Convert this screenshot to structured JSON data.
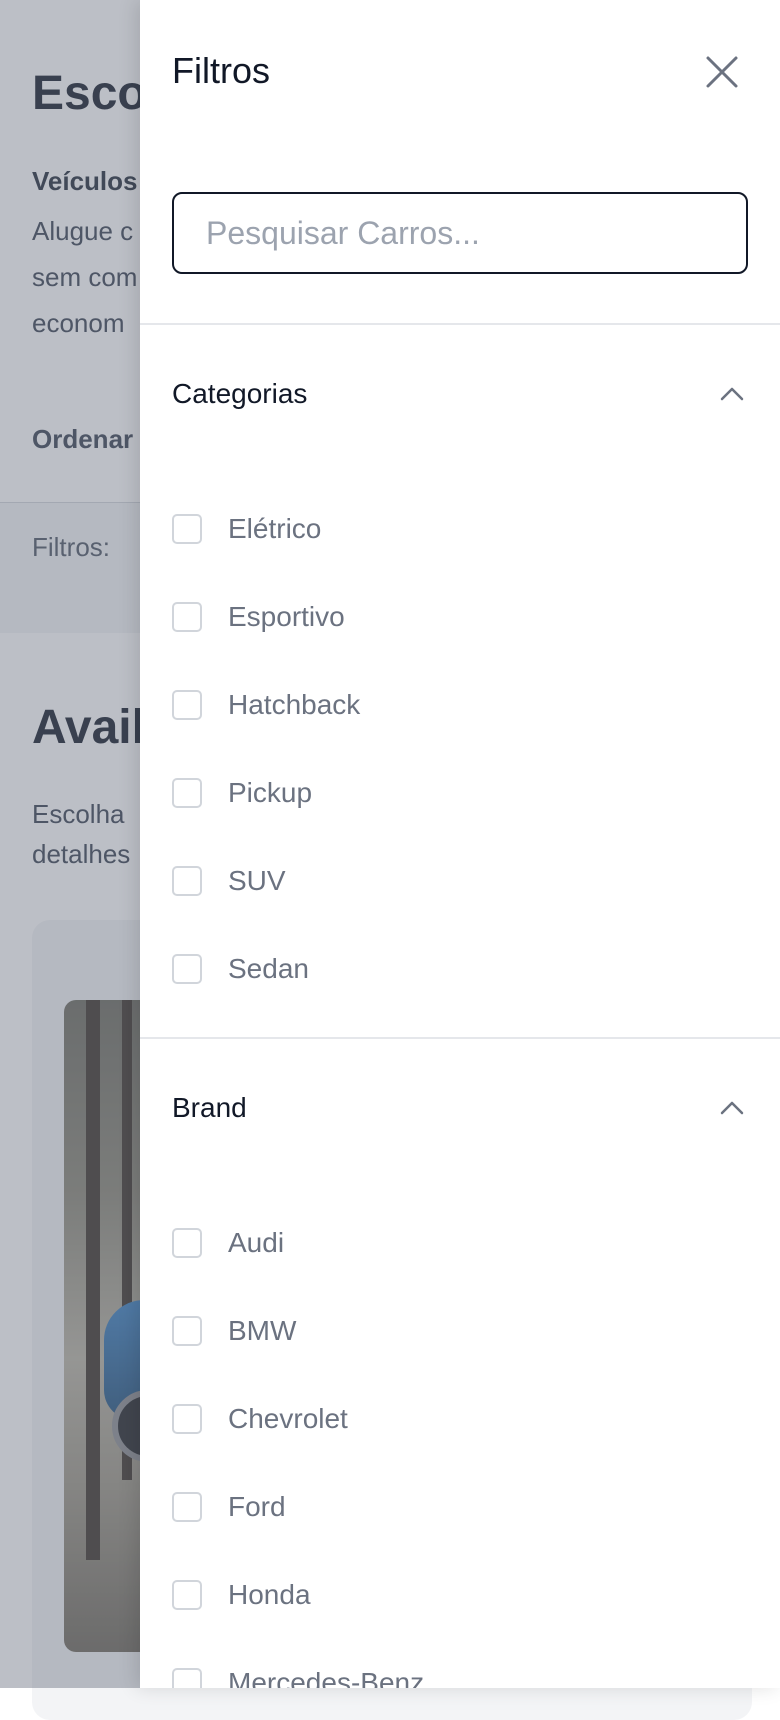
{
  "background": {
    "title": "Esco",
    "subtitle": "Veículos",
    "description_lines": [
      "Alugue c",
      "sem com",
      "econom"
    ],
    "sort_label": "Ordenar",
    "filters_label": "Filtros:",
    "available_title": "Avail",
    "available_desc_lines": [
      "Escolha",
      "detalhes"
    ]
  },
  "drawer": {
    "title": "Filtros",
    "close_icon": "close-icon",
    "search": {
      "placeholder": "Pesquisar Carros...",
      "value": ""
    },
    "sections": [
      {
        "title": "Categorias",
        "expanded": true,
        "chevron_icon": "chevron-up-icon",
        "options": [
          "Elétrico",
          "Esportivo",
          "Hatchback",
          "Pickup",
          "SUV",
          "Sedan"
        ]
      },
      {
        "title": "Brand",
        "expanded": true,
        "chevron_icon": "chevron-up-icon",
        "options": [
          "Audi",
          "BMW",
          "Chevrolet",
          "Ford",
          "Honda",
          "Mercedes-Benz"
        ]
      }
    ]
  },
  "colors": {
    "overlay": "#6b7280",
    "text_primary": "#111827",
    "text_muted": "#6b7280",
    "border": "#d1d5db"
  }
}
